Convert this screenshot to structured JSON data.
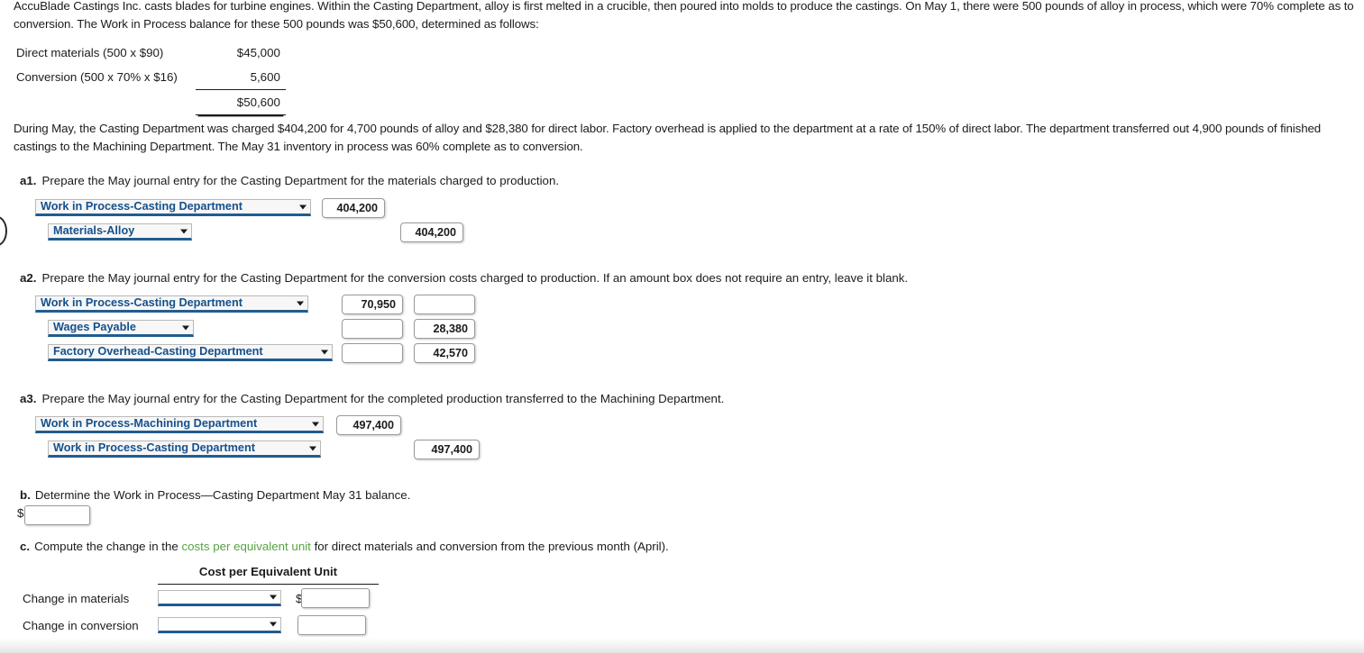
{
  "problem": {
    "intro": "AccuBlade Castings Inc. casts blades for turbine engines. Within the Casting Department, alloy is first melted in a crucible, then poured into molds to produce the castings. On May 1, there were 500 pounds of alloy in process, which were 70% complete as to conversion. The Work in Process balance for these 500 pounds was $50,600, determined as follows:",
    "may_activity": "During May, the Casting Department was charged $404,200 for 4,700 pounds of alloy and $28,380 for direct labor. Factory overhead is applied to the department at a rate of 150% of direct labor. The department transferred out 4,900 pounds of finished castings to the Machining Department. The May 31 inventory in process was 60% complete as to conversion."
  },
  "opening_balance_table": {
    "rows": [
      {
        "label": "Direct materials (500 x $90)",
        "amount": "$45,000"
      },
      {
        "label": "Conversion (500 x 70% x $16)",
        "amount": "5,600"
      }
    ],
    "total": "$50,600"
  },
  "questions": {
    "a1": {
      "tag": "a1.",
      "text": "Prepare the May journal entry for the Casting Department for the materials charged to production.",
      "entries": [
        {
          "account": "Work in Process-Casting Department",
          "debit": "404,200",
          "credit": ""
        },
        {
          "account": "Materials-Alloy",
          "debit": "",
          "credit": "404,200"
        }
      ]
    },
    "a2": {
      "tag": "a2.",
      "text": "Prepare the May journal entry for the Casting Department for the conversion costs charged to production. If an amount box does not require an entry, leave it blank.",
      "entries": [
        {
          "account": "Work in Process-Casting Department",
          "debit": "70,950",
          "credit": ""
        },
        {
          "account": "Wages Payable",
          "debit": "",
          "credit": "28,380"
        },
        {
          "account": "Factory Overhead-Casting Department",
          "debit": "",
          "credit": "42,570"
        }
      ]
    },
    "a3": {
      "tag": "a3.",
      "text": "Prepare the May journal entry for the Casting Department for the completed production transferred to the Machining Department.",
      "entries": [
        {
          "account": "Work in Process-Machining Department",
          "debit": "497,400",
          "credit": ""
        },
        {
          "account": "Work in Process-Casting Department",
          "debit": "",
          "credit": "497,400"
        }
      ]
    },
    "b": {
      "tag": "b.",
      "text": "Determine the Work in Process—Casting Department May 31 balance.",
      "dollar_sign": "$",
      "value": "",
      "placeholder": ""
    },
    "c": {
      "tag": "c.",
      "text_before_link": "Compute the change in the ",
      "link_text": "costs per equivalent unit",
      "text_after_link": " for direct materials and conversion from the previous month (April).",
      "table_header": "Cost per Equivalent Unit",
      "rows": [
        {
          "label": "Change in materials",
          "direction": "",
          "dollar_sign": "$",
          "amount": ""
        },
        {
          "label": "Change in conversion",
          "direction": "",
          "dollar_sign": "",
          "amount": ""
        }
      ]
    }
  },
  "colors": {
    "link_green": "#57a442",
    "select_text": "#15508c",
    "select_underline": "#215c8f",
    "body_text": "#1b1b1b"
  },
  "icons": {
    "dropdown_caret": "chevron-down-icon"
  }
}
